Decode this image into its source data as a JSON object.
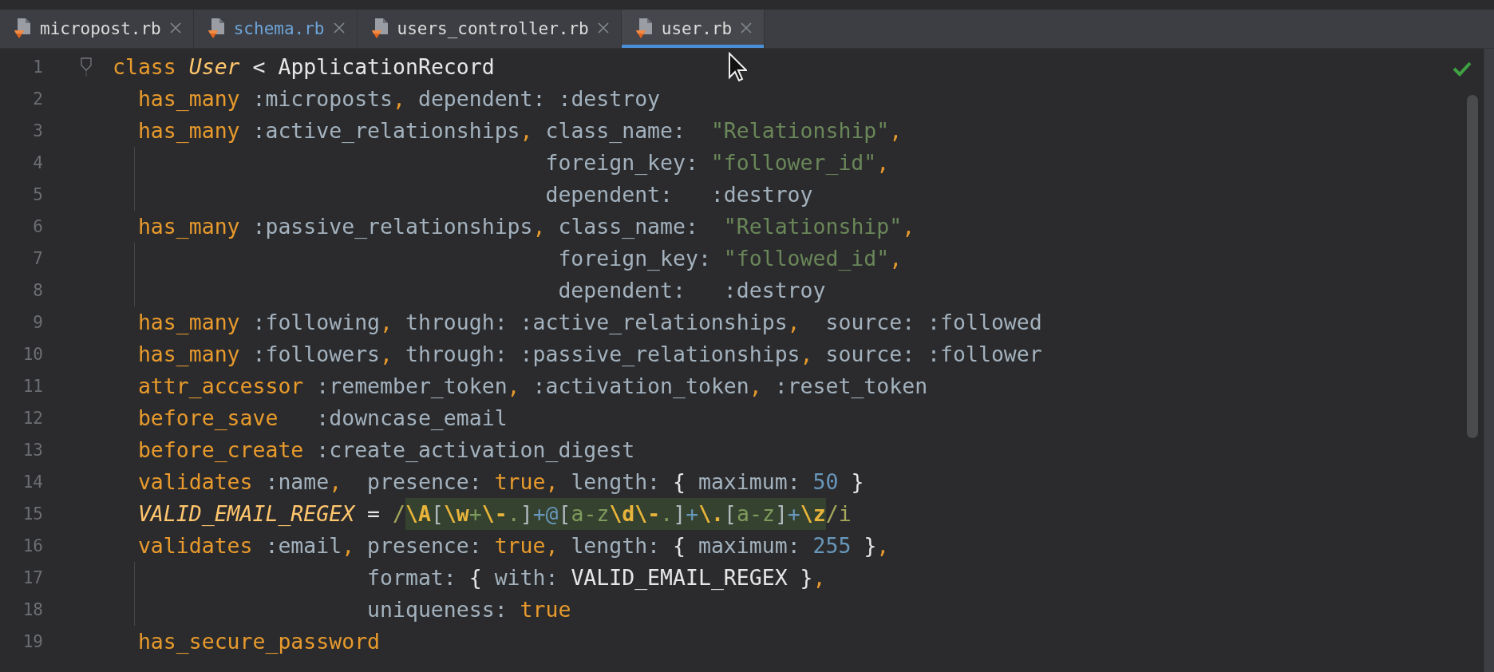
{
  "tabs": [
    {
      "label": "micropost.rb",
      "selected": false,
      "modified": false
    },
    {
      "label": "schema.rb",
      "selected": false,
      "modified": true
    },
    {
      "label": "users_controller.rb",
      "selected": false,
      "modified": false
    },
    {
      "label": "user.rb",
      "selected": true,
      "modified": false
    }
  ],
  "editor": {
    "inspection_passed": true,
    "lines": [
      {
        "n": "1",
        "fold": true,
        "guide": false,
        "tokens": [
          {
            "kind": "kw",
            "text": "class "
          },
          {
            "kind": "cls",
            "text": "User"
          },
          {
            "kind": "plain",
            "text": " < ApplicationRecord"
          }
        ]
      },
      {
        "n": "2",
        "fold": false,
        "guide": false,
        "tokens": [
          {
            "kind": "kw",
            "text": "  has_many"
          },
          {
            "kind": "sym",
            "text": " :microposts"
          },
          {
            "kind": "kw",
            "text": ","
          },
          {
            "kind": "sym",
            "text": " dependent: :destroy"
          }
        ]
      },
      {
        "n": "3",
        "fold": false,
        "guide": false,
        "tokens": [
          {
            "kind": "kw",
            "text": "  has_many"
          },
          {
            "kind": "sym",
            "text": " :active_relationships"
          },
          {
            "kind": "kw",
            "text": ","
          },
          {
            "kind": "sym",
            "text": " class_name:  "
          },
          {
            "kind": "str",
            "text": "\"Relationship\""
          },
          {
            "kind": "kw",
            "text": ","
          }
        ]
      },
      {
        "n": "4",
        "fold": false,
        "guide": true,
        "tokens": [
          {
            "kind": "sym",
            "text": "                                  foreign_key: "
          },
          {
            "kind": "str",
            "text": "\"follower_id\""
          },
          {
            "kind": "kw",
            "text": ","
          }
        ]
      },
      {
        "n": "5",
        "fold": false,
        "guide": true,
        "tokens": [
          {
            "kind": "sym",
            "text": "                                  dependent:   :destroy"
          }
        ]
      },
      {
        "n": "6",
        "fold": false,
        "guide": false,
        "tokens": [
          {
            "kind": "kw",
            "text": "  has_many"
          },
          {
            "kind": "sym",
            "text": " :passive_relationships"
          },
          {
            "kind": "kw",
            "text": ","
          },
          {
            "kind": "sym",
            "text": " class_name:  "
          },
          {
            "kind": "str",
            "text": "\"Relationship\""
          },
          {
            "kind": "kw",
            "text": ","
          }
        ]
      },
      {
        "n": "7",
        "fold": false,
        "guide": true,
        "tokens": [
          {
            "kind": "sym",
            "text": "                                   foreign_key: "
          },
          {
            "kind": "str",
            "text": "\"followed_id\""
          },
          {
            "kind": "kw",
            "text": ","
          }
        ]
      },
      {
        "n": "8",
        "fold": false,
        "guide": true,
        "tokens": [
          {
            "kind": "sym",
            "text": "                                   dependent:   :destroy"
          }
        ]
      },
      {
        "n": "9",
        "fold": false,
        "guide": false,
        "tokens": [
          {
            "kind": "kw",
            "text": "  has_many"
          },
          {
            "kind": "sym",
            "text": " :following"
          },
          {
            "kind": "kw",
            "text": ","
          },
          {
            "kind": "sym",
            "text": " through: :active_relationships"
          },
          {
            "kind": "kw",
            "text": ","
          },
          {
            "kind": "sym",
            "text": "  source: :followed"
          }
        ]
      },
      {
        "n": "10",
        "fold": false,
        "guide": false,
        "tokens": [
          {
            "kind": "kw",
            "text": "  has_many"
          },
          {
            "kind": "sym",
            "text": " :followers"
          },
          {
            "kind": "kw",
            "text": ","
          },
          {
            "kind": "sym",
            "text": " through: :passive_relationships"
          },
          {
            "kind": "kw",
            "text": ","
          },
          {
            "kind": "sym",
            "text": " source: :follower"
          }
        ]
      },
      {
        "n": "11",
        "fold": false,
        "guide": false,
        "tokens": [
          {
            "kind": "kw",
            "text": "  attr_accessor"
          },
          {
            "kind": "sym",
            "text": " :remember_token"
          },
          {
            "kind": "kw",
            "text": ","
          },
          {
            "kind": "sym",
            "text": " :activation_token"
          },
          {
            "kind": "kw",
            "text": ","
          },
          {
            "kind": "sym",
            "text": " :reset_token"
          }
        ]
      },
      {
        "n": "12",
        "fold": false,
        "guide": false,
        "tokens": [
          {
            "kind": "kw",
            "text": "  before_save"
          },
          {
            "kind": "sym",
            "text": "   :downcase_email"
          }
        ]
      },
      {
        "n": "13",
        "fold": false,
        "guide": false,
        "tokens": [
          {
            "kind": "kw",
            "text": "  before_create"
          },
          {
            "kind": "sym",
            "text": " :create_activation_digest"
          }
        ]
      },
      {
        "n": "14",
        "fold": false,
        "guide": false,
        "tokens": [
          {
            "kind": "kw",
            "text": "  validates"
          },
          {
            "kind": "sym",
            "text": " :name"
          },
          {
            "kind": "kw",
            "text": ","
          },
          {
            "kind": "sym",
            "text": "  presence: "
          },
          {
            "kind": "kw",
            "text": "true,"
          },
          {
            "kind": "sym",
            "text": " length: "
          },
          {
            "kind": "plain",
            "text": "{ "
          },
          {
            "kind": "sym",
            "text": "maximum: "
          },
          {
            "kind": "num",
            "text": "50"
          },
          {
            "kind": "plain",
            "text": " }"
          }
        ]
      },
      {
        "n": "15",
        "fold": false,
        "guide": false,
        "tokens": [
          {
            "kind": "const",
            "text": "  VALID_EMAIL_REGEX"
          },
          {
            "kind": "plain",
            "text": " = "
          },
          {
            "kind": "re_delim",
            "text": "/"
          },
          {
            "kind": "hl",
            "parts": [
              {
                "kind": "re_esc",
                "text": "\\A"
              },
              {
                "kind": "re_br",
                "text": "["
              },
              {
                "kind": "re_esc",
                "text": "\\w"
              },
              {
                "kind": "re_ch",
                "text": "+"
              },
              {
                "kind": "re_esc",
                "text": "\\-"
              },
              {
                "kind": "re_ch",
                "text": "."
              },
              {
                "kind": "re_br",
                "text": "]"
              },
              {
                "kind": "re_op",
                "text": "+@"
              },
              {
                "kind": "re_br",
                "text": "["
              },
              {
                "kind": "re_ch",
                "text": "a-z"
              },
              {
                "kind": "re_esc",
                "text": "\\d\\-"
              },
              {
                "kind": "re_ch",
                "text": "."
              },
              {
                "kind": "re_br",
                "text": "]"
              },
              {
                "kind": "re_op",
                "text": "+"
              },
              {
                "kind": "re_esc",
                "text": "\\."
              },
              {
                "kind": "re_br",
                "text": "["
              },
              {
                "kind": "re_ch",
                "text": "a-z"
              },
              {
                "kind": "re_br",
                "text": "]"
              },
              {
                "kind": "re_op",
                "text": "+"
              },
              {
                "kind": "re_esc",
                "text": "\\z"
              }
            ]
          },
          {
            "kind": "re_delim",
            "text": "/i"
          }
        ]
      },
      {
        "n": "16",
        "fold": false,
        "guide": false,
        "tokens": [
          {
            "kind": "kw",
            "text": "  validates"
          },
          {
            "kind": "sym",
            "text": " :email"
          },
          {
            "kind": "kw",
            "text": ","
          },
          {
            "kind": "sym",
            "text": " presence: "
          },
          {
            "kind": "kw",
            "text": "true,"
          },
          {
            "kind": "sym",
            "text": " length: "
          },
          {
            "kind": "plain",
            "text": "{ "
          },
          {
            "kind": "sym",
            "text": "maximum: "
          },
          {
            "kind": "num",
            "text": "255"
          },
          {
            "kind": "plain",
            "text": " }"
          },
          {
            "kind": "kw",
            "text": ","
          }
        ]
      },
      {
        "n": "17",
        "fold": false,
        "guide": true,
        "tokens": [
          {
            "kind": "sym",
            "text": "                    format: "
          },
          {
            "kind": "plain",
            "text": "{ "
          },
          {
            "kind": "sym",
            "text": "with: "
          },
          {
            "kind": "plain",
            "text": "VALID_EMAIL_REGEX }"
          },
          {
            "kind": "kw",
            "text": ","
          }
        ]
      },
      {
        "n": "18",
        "fold": false,
        "guide": true,
        "tokens": [
          {
            "kind": "sym",
            "text": "                    uniqueness: "
          },
          {
            "kind": "kw",
            "text": "true"
          }
        ]
      },
      {
        "n": "19",
        "fold": false,
        "guide": false,
        "tokens": [
          {
            "kind": "kw",
            "text": "  has_secure_password"
          }
        ]
      }
    ]
  }
}
